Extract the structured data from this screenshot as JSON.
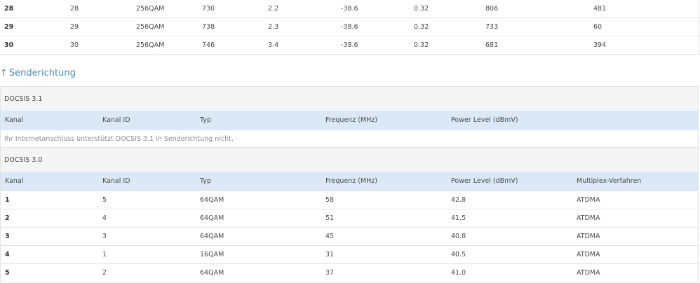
{
  "downstream": {
    "rows": [
      {
        "kanal": "28",
        "kanal_id": "28",
        "modulation": "256QAM",
        "frequenz": "730",
        "power": "2.2",
        "mse": "-38.6",
        "latenz": "0.32",
        "korr": "806",
        "nonkorr": "481"
      },
      {
        "kanal": "29",
        "kanal_id": "29",
        "modulation": "256QAM",
        "frequenz": "738",
        "power": "2.3",
        "mse": "-38.6",
        "latenz": "0.32",
        "korr": "733",
        "nonkorr": "60"
      },
      {
        "kanal": "30",
        "kanal_id": "30",
        "modulation": "256QAM",
        "frequenz": "746",
        "power": "3.4",
        "mse": "-38.6",
        "latenz": "0.32",
        "korr": "681",
        "nonkorr": "394"
      }
    ]
  },
  "upstream": {
    "arrow": "↑",
    "title": "Senderichtung",
    "docsis31": {
      "label": "DOCSIS 3.1",
      "headers": [
        "Kanal",
        "Kanal ID",
        "Typ",
        "Frequenz (MHz)",
        "Power Level (dBmV)"
      ],
      "notice": "Ihr Internetanschluss unterstützt DOCSIS 3.1 in Senderichtung nicht."
    },
    "docsis30": {
      "label": "DOCSIS 3.0",
      "headers": [
        "Kanal",
        "Kanal ID",
        "Typ",
        "Frequenz (MHz)",
        "Power Level (dBmV)",
        "Multiplex-Verfahren"
      ],
      "rows": [
        {
          "kanal": "1",
          "kanal_id": "5",
          "typ": "64QAM",
          "frequenz": "58",
          "power": "42.8",
          "multiplex": "ATDMA"
        },
        {
          "kanal": "2",
          "kanal_id": "4",
          "typ": "64QAM",
          "frequenz": "51",
          "power": "41.5",
          "multiplex": "ATDMA"
        },
        {
          "kanal": "3",
          "kanal_id": "3",
          "typ": "64QAM",
          "frequenz": "45",
          "power": "40.8",
          "multiplex": "ATDMA"
        },
        {
          "kanal": "4",
          "kanal_id": "1",
          "typ": "16QAM",
          "frequenz": "31",
          "power": "40.5",
          "multiplex": "ATDMA"
        },
        {
          "kanal": "5",
          "kanal_id": "2",
          "typ": "64QAM",
          "frequenz": "37",
          "power": "41.0",
          "multiplex": "ATDMA"
        }
      ]
    }
  }
}
